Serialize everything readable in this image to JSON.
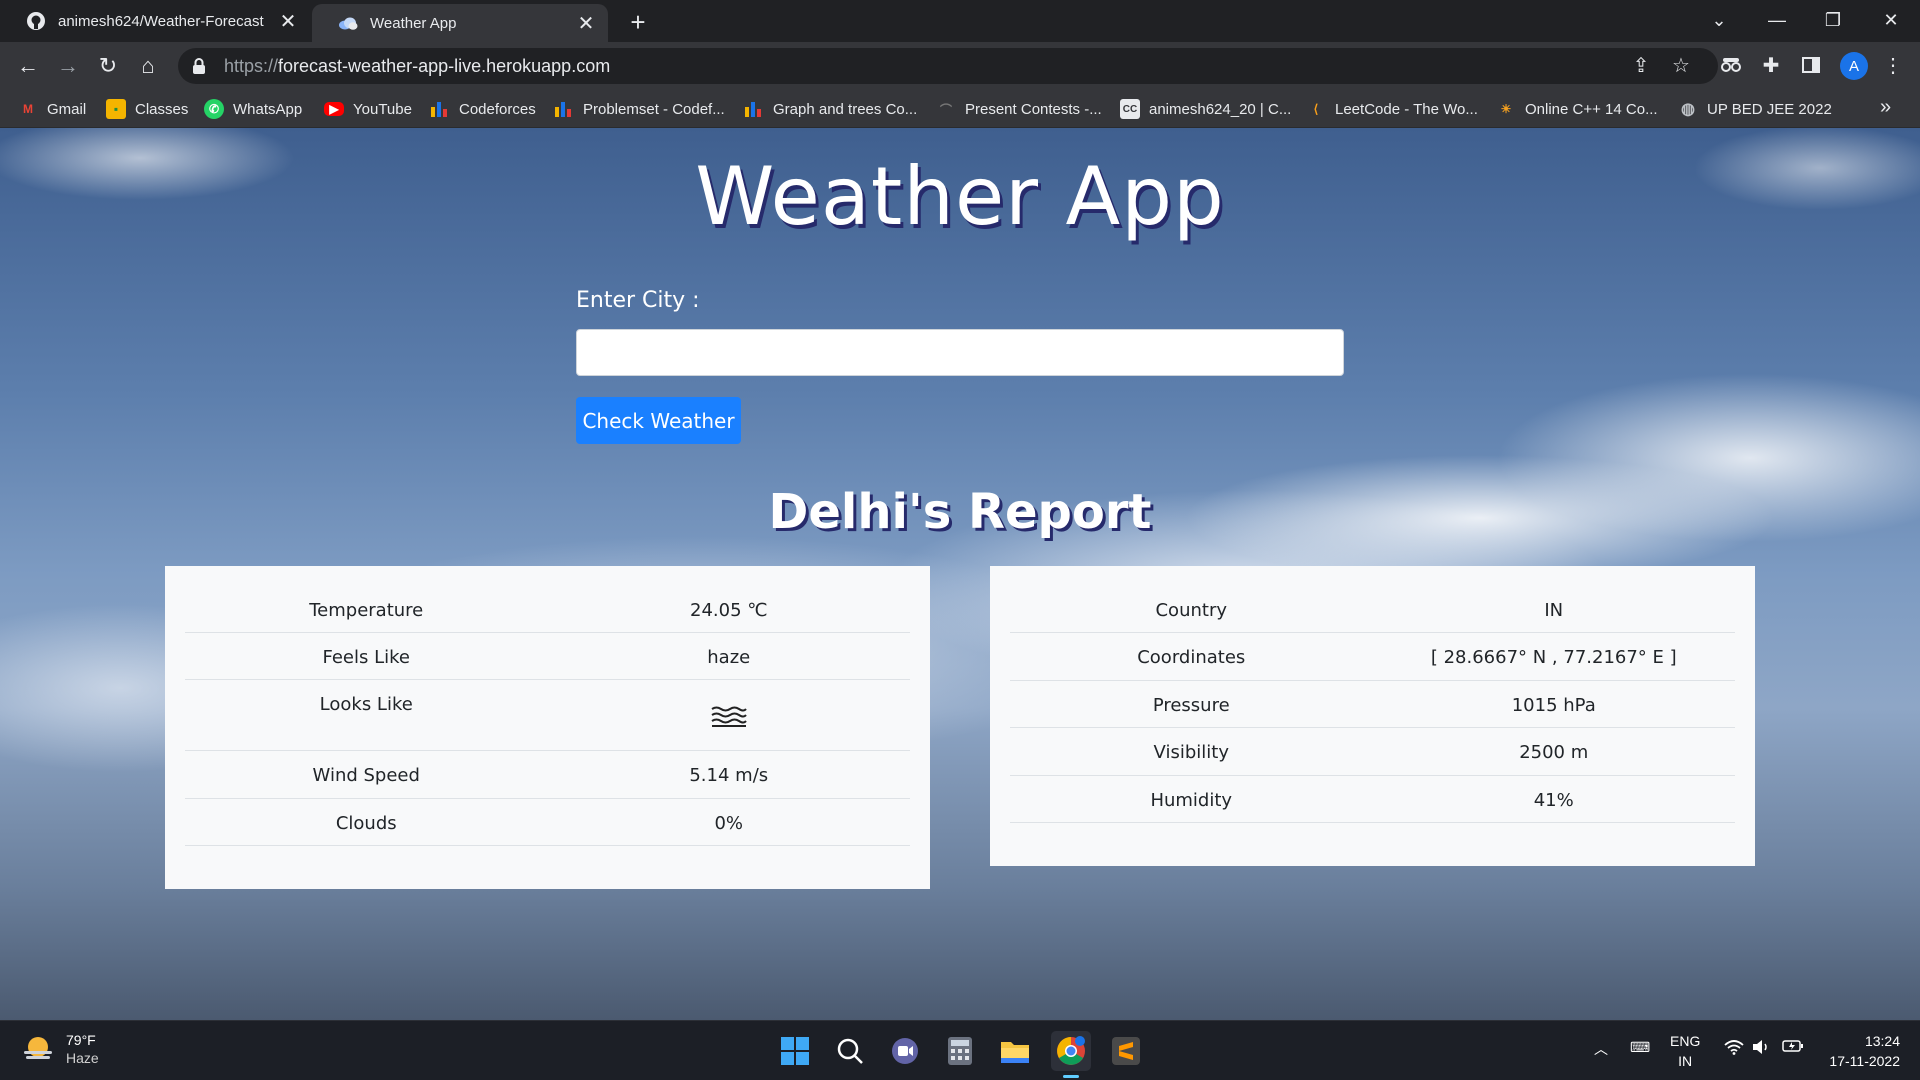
{
  "browser": {
    "tabs": [
      {
        "title": "animesh624/Weather-Forecast",
        "icon": "github-icon",
        "active": false
      },
      {
        "title": "Weather App",
        "icon": "cloud-icon",
        "active": true
      }
    ],
    "url_scheme": "https://",
    "url_host": "forecast-weather-app-live.herokuapp.com",
    "bookmarks": [
      {
        "label": "Gmail",
        "icon": "gmail-icon"
      },
      {
        "label": "Classes",
        "icon": "classroom-icon"
      },
      {
        "label": "WhatsApp",
        "icon": "whatsapp-icon"
      },
      {
        "label": "YouTube",
        "icon": "youtube-icon"
      },
      {
        "label": "Codeforces",
        "icon": "codeforces-icon"
      },
      {
        "label": "Problemset - Codef...",
        "icon": "codeforces-icon"
      },
      {
        "label": "Graph and trees Co...",
        "icon": "codeforces-icon"
      },
      {
        "label": "Present Contests -...",
        "icon": "contest-icon"
      },
      {
        "label": "animesh624_20 | C...",
        "icon": "codechef-icon"
      },
      {
        "label": "LeetCode - The Wo...",
        "icon": "leetcode-icon"
      },
      {
        "label": "Online C++ 14 Co...",
        "icon": "compiler-icon"
      },
      {
        "label": "UP BED JEE 2022",
        "icon": "globe-icon"
      }
    ],
    "profile_initial": "A"
  },
  "page": {
    "title": "Weather App",
    "city_label": "Enter City :",
    "city_value": "",
    "button_label": "Check Weather",
    "report_title": "Delhi's Report",
    "left_table": [
      {
        "label": "Temperature",
        "value": "24.05 ℃"
      },
      {
        "label": "Feels Like",
        "value": "haze"
      },
      {
        "label": "Looks Like",
        "value": "",
        "icon": "haze-icon"
      },
      {
        "label": "Wind Speed",
        "value": "5.14 m/s"
      },
      {
        "label": "Clouds",
        "value": "0%"
      }
    ],
    "right_table": [
      {
        "label": "Country",
        "value": "IN"
      },
      {
        "label": "Coordinates",
        "value": "[ 28.6667° N , 77.2167° E ]"
      },
      {
        "label": "Pressure",
        "value": "1015 hPa"
      },
      {
        "label": "Visibility",
        "value": "2500 m"
      },
      {
        "label": "Humidity",
        "value": "41%"
      }
    ]
  },
  "taskbar": {
    "weather_temp": "79°F",
    "weather_desc": "Haze",
    "lang_top": "ENG",
    "lang_bottom": "IN",
    "time": "13:24",
    "date": "17-11-2022"
  },
  "colors": {
    "button": "#1a80ff",
    "title_shadow": "#262a6b",
    "card_bg": "#f8f9fa"
  }
}
